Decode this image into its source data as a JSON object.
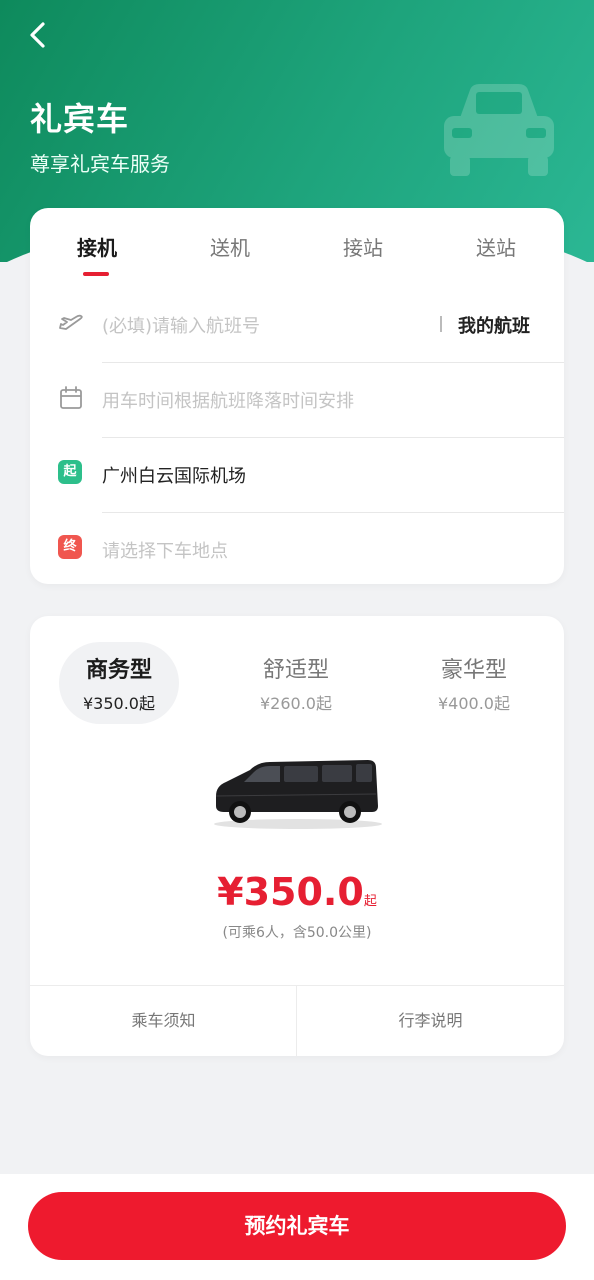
{
  "header": {
    "title": "礼宾车",
    "subtitle": "尊享礼宾车服务",
    "back_icon": "chevron-left-icon",
    "accent_gradient": [
      "#0e8a5c",
      "#2bb794"
    ]
  },
  "tabs": [
    {
      "label": "接机",
      "active": true
    },
    {
      "label": "送机",
      "active": false
    },
    {
      "label": "接站",
      "active": false
    },
    {
      "label": "送站",
      "active": false
    }
  ],
  "form": {
    "flight_placeholder": "(必填)请输入航班号",
    "my_flight_label": "我的航班",
    "time_placeholder": "用车时间根据航班降落时间安排",
    "start_badge": "起",
    "start_value": "广州白云国际机场",
    "end_badge": "终",
    "end_placeholder": "请选择下车地点"
  },
  "car_types": [
    {
      "name": "商务型",
      "price": "¥350.0起",
      "active": true
    },
    {
      "name": "舒适型",
      "price": "¥260.0起",
      "active": false
    },
    {
      "name": "豪华型",
      "price": "¥400.0起",
      "active": false
    }
  ],
  "selected": {
    "price": "¥350.0",
    "price_suffix": "起",
    "capacity": "(可乘6人，含50.0公里)"
  },
  "links": {
    "ride_notice": "乘车须知",
    "luggage_info": "行李说明"
  },
  "cta": {
    "label": "预约礼宾车",
    "color": "#ee1a2e"
  }
}
